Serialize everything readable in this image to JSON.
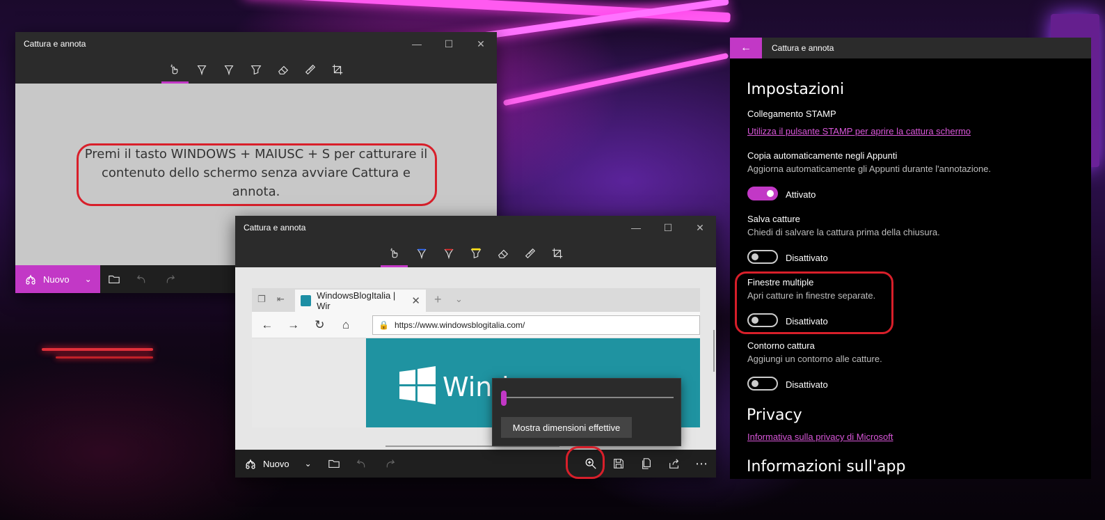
{
  "app": {
    "title": "Cattura e annota",
    "new_label": "Nuovo"
  },
  "window1": {
    "hint_text": "Premi il tasto WINDOWS + MAIUSC + S per catturare il contenuto dello schermo senza avviare Cattura e annota."
  },
  "window2": {
    "browser": {
      "tab_title": "WindowsBlogItalia | Wir",
      "url": "https://www.windowsblogitalia.com/",
      "hero_text": "Windo"
    },
    "zoom": {
      "button_label": "Mostra dimensioni effettive",
      "level": 0.0
    }
  },
  "settings": {
    "header_title": "Cattura e annota",
    "heading": "Impostazioni",
    "stamp": {
      "label": "Collegamento STAMP",
      "link": "Utilizza il pulsante STAMP per aprire la cattura schermo"
    },
    "clipboard": {
      "label": "Copia automaticamente negli Appunti",
      "desc": "Aggiorna automaticamente gli Appunti durante l'annotazione.",
      "state": "Attivato",
      "on": true
    },
    "save": {
      "label": "Salva catture",
      "desc": "Chiedi di salvare la cattura prima della chiusura.",
      "state": "Disattivato",
      "on": false
    },
    "multiple": {
      "label": "Finestre multiple",
      "desc": "Apri catture in finestre separate.",
      "state": "Disattivato",
      "on": false
    },
    "border": {
      "label": "Contorno cattura",
      "desc": "Aggiungi un contorno alle catture.",
      "state": "Disattivato",
      "on": false
    },
    "privacy_heading": "Privacy",
    "privacy_link": "Informativa sulla privacy di Microsoft",
    "about_heading": "Informazioni sull'app"
  },
  "colors": {
    "accent": "#c238c6",
    "callout": "#d81f2a",
    "link": "#d957d9"
  }
}
